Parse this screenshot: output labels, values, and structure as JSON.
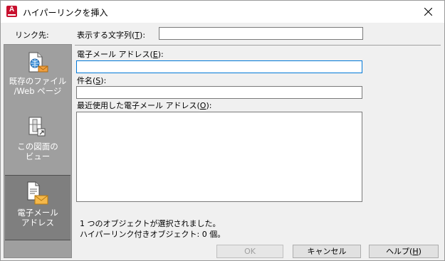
{
  "window": {
    "title": "ハイパーリンクを挿入"
  },
  "sidebar": {
    "label": "リンク先:",
    "items": [
      {
        "line1": "既存のファイル",
        "line2": "/Web ページ",
        "icon": "web-file-icon",
        "selected": false
      },
      {
        "line1": "この図面の",
        "line2": "ビュー",
        "icon": "drawing-view-icon",
        "selected": false
      },
      {
        "line1": "電子メール",
        "line2": "アドレス",
        "icon": "email-icon",
        "selected": true
      }
    ]
  },
  "form": {
    "display_text_label": "表示する文字列(",
    "display_text_key": "T",
    "display_text_label_end": "):",
    "display_text_value": "",
    "email_label": "電子メール アドレス(",
    "email_key": "E",
    "email_label_end": "):",
    "email_value": "",
    "subject_label": "件名(",
    "subject_key": "S",
    "subject_label_end": "):",
    "subject_value": "",
    "recent_label": "最近使用した電子メール アドレス(",
    "recent_key": "O",
    "recent_label_end": "):",
    "recent_items": []
  },
  "status": {
    "line1": "1 つのオブジェクトが選択されました。",
    "line2": "ハイパーリンク付きオブジェクト: 0 個。"
  },
  "buttons": {
    "ok": "OK",
    "cancel": "キャンセル",
    "help_text": "ヘルプ(",
    "help_key": "H",
    "help_end": ")"
  },
  "colors": {
    "app_icon": "#c8102e",
    "panel_bg": "#9f9f9f",
    "panel_selected": "#7f7f7f",
    "focus_border": "#0078d7"
  }
}
